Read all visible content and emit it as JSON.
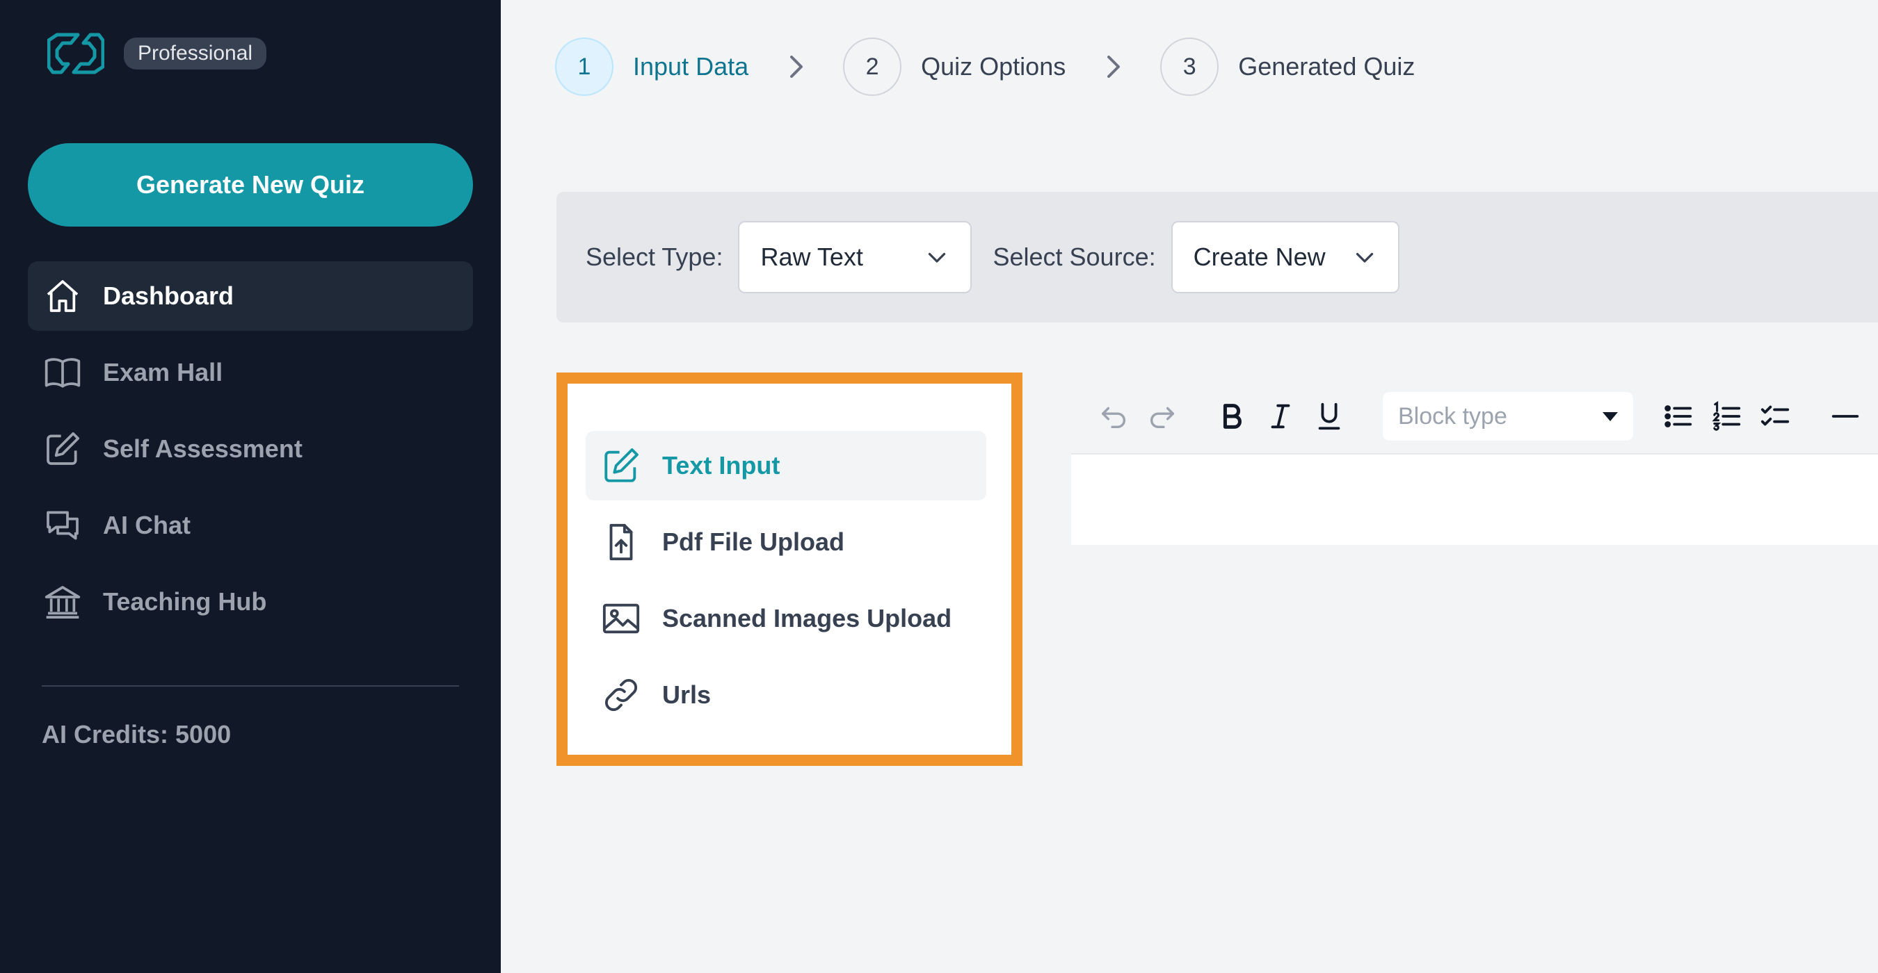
{
  "sidebar": {
    "plan_badge": "Professional",
    "generate_button": "Generate New Quiz",
    "nav": [
      {
        "label": "Dashboard",
        "icon": "home-icon",
        "active": true
      },
      {
        "label": "Exam Hall",
        "icon": "book-icon"
      },
      {
        "label": "Self Assessment",
        "icon": "edit-icon"
      },
      {
        "label": "AI Chat",
        "icon": "chat-icon"
      },
      {
        "label": "Teaching Hub",
        "icon": "bank-icon"
      }
    ],
    "credits": "AI Credits: 5000"
  },
  "stepper": {
    "steps": [
      {
        "number": "1",
        "label": "Input Data",
        "active": true
      },
      {
        "number": "2",
        "label": "Quiz Options"
      },
      {
        "number": "3",
        "label": "Generated Quiz"
      }
    ]
  },
  "select_bar": {
    "type_label": "Select Type:",
    "type_value": "Raw Text",
    "source_label": "Select Source:",
    "source_value": "Create New"
  },
  "input_types": [
    {
      "label": "Text Input",
      "icon": "pencil-square-icon",
      "active": true
    },
    {
      "label": "Pdf File Upload",
      "icon": "file-upload-icon"
    },
    {
      "label": "Scanned Images Upload",
      "icon": "image-icon"
    },
    {
      "label": "Urls",
      "icon": "link-icon"
    }
  ],
  "editor": {
    "block_type_placeholder": "Block type"
  },
  "colors": {
    "sidebar_bg": "#111827",
    "accent": "#1598a6",
    "highlight_border": "#f0932b"
  }
}
